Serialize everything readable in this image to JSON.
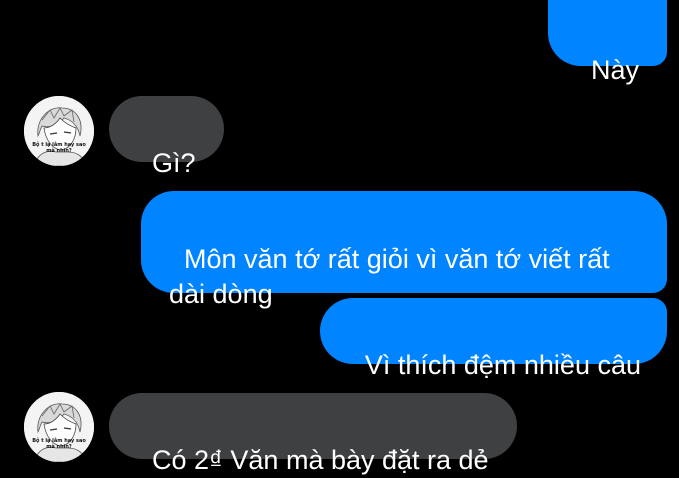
{
  "conversation": {
    "messages": [
      {
        "sender": "me",
        "text": "Này"
      },
      {
        "sender": "other",
        "text": "Gì?"
      },
      {
        "sender": "me",
        "text": "Môn văn tớ rất giỏi vì văn tớ viết rất\ndài dòng"
      },
      {
        "sender": "me",
        "text": "Vì thích đệm nhiều câu"
      },
      {
        "sender": "other",
        "text": "Có 2₫ Văn mà bày đặt ra dẻ"
      }
    ],
    "avatar": {
      "icon": "anime-avatar-icon",
      "caption_line1": "Bộ t lạ lắm hay sao",
      "caption_line2": "mà nhìn?"
    }
  },
  "colors": {
    "background": "#000000",
    "outgoing_bubble": "#0084ff",
    "incoming_bubble": "#3e4042",
    "text": "#ffffff"
  }
}
